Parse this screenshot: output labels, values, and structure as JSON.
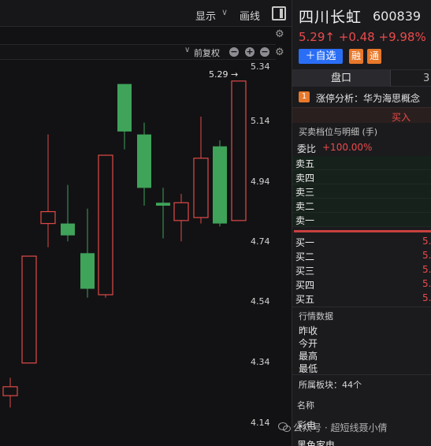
{
  "toolbar": {
    "display_label": "显示",
    "draw_label": "画线",
    "adjust_label": "前复权"
  },
  "chart": {
    "last_price_tag": "5.29",
    "price_axis": [
      "5.34",
      "5.14",
      "4.94",
      "4.74",
      "4.54",
      "4.34",
      "4.14"
    ],
    "up_color": "#e04a48",
    "down_color": "#3fa35a"
  },
  "chart_data": {
    "type": "candlestick",
    "y_axis_ticks": [
      5.34,
      5.14,
      4.94,
      4.74,
      4.54,
      4.34,
      4.14
    ],
    "ylim": [
      4.11,
      5.38
    ],
    "candles": [
      {
        "open": 4.23,
        "close": 4.26,
        "high": 4.29,
        "low": 4.19,
        "dir": "up"
      },
      {
        "open": 4.34,
        "close": 4.7,
        "high": 4.7,
        "low": 4.34,
        "dir": "up"
      },
      {
        "open": 4.81,
        "close": 4.85,
        "high": 5.11,
        "low": 4.73,
        "dir": "up"
      },
      {
        "open": 4.81,
        "close": 4.77,
        "high": 4.94,
        "low": 4.75,
        "dir": "down"
      },
      {
        "open": 4.71,
        "close": 4.59,
        "high": 4.86,
        "low": 4.56,
        "dir": "down"
      },
      {
        "open": 4.57,
        "close": 5.04,
        "high": 5.04,
        "low": 4.56,
        "dir": "up"
      },
      {
        "open": 5.28,
        "close": 5.12,
        "high": 5.28,
        "low": 5.06,
        "dir": "down"
      },
      {
        "open": 5.11,
        "close": 4.93,
        "high": 5.15,
        "low": 4.87,
        "dir": "down"
      },
      {
        "open": 4.88,
        "close": 4.87,
        "high": 4.93,
        "low": 4.76,
        "dir": "down"
      },
      {
        "open": 4.82,
        "close": 4.88,
        "high": 4.91,
        "low": 4.75,
        "dir": "up"
      },
      {
        "open": 4.83,
        "close": 5.03,
        "high": 5.17,
        "low": 4.81,
        "dir": "up"
      },
      {
        "open": 5.07,
        "close": 4.81,
        "high": 5.09,
        "low": 4.8,
        "dir": "down"
      },
      {
        "open": 4.82,
        "close": 5.29,
        "high": 5.29,
        "low": 4.82,
        "dir": "up"
      }
    ]
  },
  "stock": {
    "name": "四川长虹",
    "code": "600839",
    "price": "5.29↑",
    "change": "+0.48",
    "change_pct": "+9.98%",
    "add_watch": "＋自选",
    "badge_rong": "融",
    "badge_tong": "通"
  },
  "tabs": {
    "pankou": "盘口",
    "next": "3"
  },
  "limit_up": {
    "icon": "1",
    "text": "涨停分析：华为海思概念"
  },
  "buy_bar_label": "买入",
  "depth": {
    "title": "买卖档位与明细 (手)",
    "weibi_label": "委比",
    "weibi_value": "+100.00%",
    "asks": [
      "卖五",
      "卖四",
      "卖三",
      "卖二",
      "卖一"
    ],
    "bids": [
      {
        "label": "买一",
        "value": "5."
      },
      {
        "label": "买二",
        "value": "5."
      },
      {
        "label": "买三",
        "value": "5."
      },
      {
        "label": "买四",
        "value": "5."
      },
      {
        "label": "买五",
        "value": "5."
      }
    ]
  },
  "market": {
    "title": "行情数据",
    "items": [
      "昨收",
      "今开",
      "最高",
      "最低"
    ]
  },
  "sector": {
    "title": "所属板块：44个",
    "col_name": "名称",
    "items": [
      "彩电",
      "黑色家电"
    ]
  },
  "watermark": "公众号 · 超短线聂小倩"
}
